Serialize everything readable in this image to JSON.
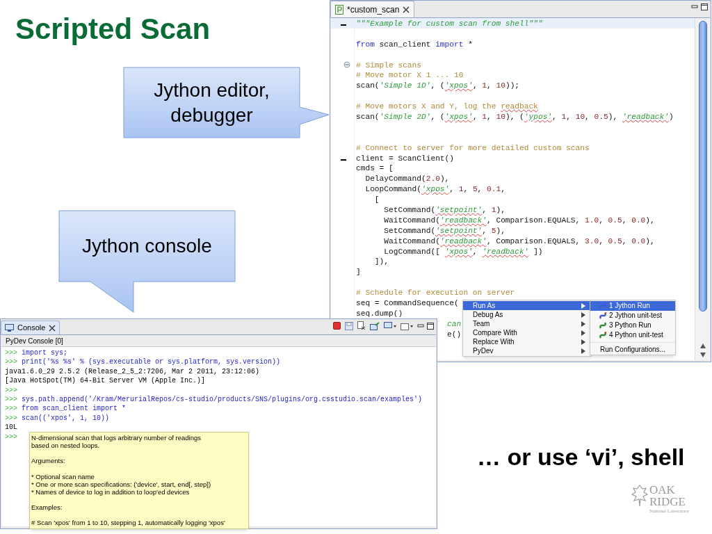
{
  "slide": {
    "title": "Scripted Scan",
    "callouts": [
      {
        "text": "Jython editor, debugger"
      },
      {
        "text": "Jython console"
      }
    ],
    "footer_text": "… or use ‘vi’, shell",
    "logo": {
      "line_1": "OAK",
      "line_2": "RIDGE",
      "line_3": "National Laboratory"
    }
  },
  "editor": {
    "tab": {
      "title": "*custom_scan"
    },
    "lines": [
      {
        "current": true,
        "marked": true,
        "foldable": false,
        "tokens": [
          {
            "kind": "docstring",
            "text": "\"\"\"Example for custom scan from shell\"\"\""
          }
        ]
      },
      {
        "current": false,
        "marked": false,
        "foldable": false
      },
      {
        "current": false,
        "marked": false,
        "foldable": false,
        "tokens": [
          {
            "kind": "keyword",
            "text": "from"
          },
          {
            "kind": "plain",
            "text": " scan_client "
          },
          {
            "kind": "keyword",
            "text": "import"
          },
          {
            "kind": "plain",
            "text": " *"
          }
        ]
      },
      {
        "current": false,
        "marked": false,
        "foldable": false
      },
      {
        "current": false,
        "marked": false,
        "foldable": true,
        "tokens": [
          {
            "kind": "comment",
            "text": "# Simple scans"
          }
        ]
      },
      {
        "current": false,
        "marked": false,
        "foldable": false,
        "tokens": [
          {
            "kind": "comment",
            "text": "# Move motor X 1 ... 10"
          }
        ]
      },
      {
        "current": false,
        "marked": false,
        "foldable": false,
        "tokens": [
          {
            "kind": "plain",
            "text": "scan("
          },
          {
            "kind": "string",
            "text": "'Simple 1D'"
          },
          {
            "kind": "plain",
            "text": ", ("
          },
          {
            "kind": "string",
            "text": "'xpos'",
            "squiggle": true
          },
          {
            "kind": "plain",
            "text": ", "
          },
          {
            "kind": "number",
            "text": "1"
          },
          {
            "kind": "plain",
            "text": ", "
          },
          {
            "kind": "number",
            "text": "10"
          },
          {
            "kind": "plain",
            "text": "));"
          }
        ]
      },
      {
        "current": false,
        "marked": false,
        "foldable": false
      },
      {
        "current": false,
        "marked": false,
        "foldable": false,
        "tokens": [
          {
            "kind": "comment",
            "text": "# Move motors X and Y, log the "
          },
          {
            "kind": "comment",
            "text": "readback",
            "squiggle": true
          }
        ]
      },
      {
        "current": false,
        "marked": false,
        "foldable": false,
        "tokens": [
          {
            "kind": "plain",
            "text": "scan("
          },
          {
            "kind": "string",
            "text": "'Simple 2D'"
          },
          {
            "kind": "plain",
            "text": ", ("
          },
          {
            "kind": "string",
            "text": "'xpos'",
            "squiggle": true
          },
          {
            "kind": "plain",
            "text": ", "
          },
          {
            "kind": "number",
            "text": "1"
          },
          {
            "kind": "plain",
            "text": ", "
          },
          {
            "kind": "number",
            "text": "10"
          },
          {
            "kind": "plain",
            "text": "), ("
          },
          {
            "kind": "string",
            "text": "'ypos'",
            "squiggle": true
          },
          {
            "kind": "plain",
            "text": ", "
          },
          {
            "kind": "number",
            "text": "1"
          },
          {
            "kind": "plain",
            "text": ", "
          },
          {
            "kind": "number",
            "text": "10"
          },
          {
            "kind": "plain",
            "text": ", "
          },
          {
            "kind": "number",
            "text": "0.5"
          },
          {
            "kind": "plain",
            "text": "), "
          },
          {
            "kind": "string",
            "text": "'readback'",
            "squiggle": true
          },
          {
            "kind": "plain",
            "text": ")"
          }
        ]
      },
      {
        "current": false,
        "marked": false,
        "foldable": false
      },
      {
        "current": false,
        "marked": false,
        "foldable": false
      },
      {
        "current": false,
        "marked": false,
        "foldable": false,
        "tokens": [
          {
            "kind": "comment",
            "text": "# Connect to server for more detailed custom scans"
          }
        ]
      },
      {
        "current": false,
        "marked": true,
        "foldable": false,
        "tokens": [
          {
            "kind": "plain",
            "text": "client = ScanClient()"
          }
        ]
      },
      {
        "current": false,
        "marked": false,
        "foldable": false,
        "tokens": [
          {
            "kind": "plain",
            "text": "cmds = ["
          }
        ]
      },
      {
        "current": false,
        "marked": false,
        "foldable": false,
        "tokens": [
          {
            "kind": "plain",
            "text": "  DelayCommand("
          },
          {
            "kind": "number",
            "text": "2.0"
          },
          {
            "kind": "plain",
            "text": "),"
          }
        ]
      },
      {
        "current": false,
        "marked": false,
        "foldable": false,
        "tokens": [
          {
            "kind": "plain",
            "text": "  LoopCommand("
          },
          {
            "kind": "string",
            "text": "'xpos'",
            "squiggle": true
          },
          {
            "kind": "plain",
            "text": ", "
          },
          {
            "kind": "number",
            "text": "1"
          },
          {
            "kind": "plain",
            "text": ", "
          },
          {
            "kind": "number",
            "text": "5"
          },
          {
            "kind": "plain",
            "text": ", "
          },
          {
            "kind": "number",
            "text": "0.1"
          },
          {
            "kind": "plain",
            "text": ","
          }
        ]
      },
      {
        "current": false,
        "marked": false,
        "foldable": false,
        "tokens": [
          {
            "kind": "plain",
            "text": "    ["
          }
        ]
      },
      {
        "current": false,
        "marked": false,
        "foldable": false,
        "tokens": [
          {
            "kind": "plain",
            "text": "      SetCommand("
          },
          {
            "kind": "string",
            "text": "'setpoint'",
            "squiggle": true
          },
          {
            "kind": "plain",
            "text": ", "
          },
          {
            "kind": "number",
            "text": "1"
          },
          {
            "kind": "plain",
            "text": "),"
          }
        ]
      },
      {
        "current": false,
        "marked": false,
        "foldable": false,
        "tokens": [
          {
            "kind": "plain",
            "text": "      WaitCommand("
          },
          {
            "kind": "string",
            "text": "'readback'",
            "squiggle": true
          },
          {
            "kind": "plain",
            "text": ", Comparison.EQUALS, "
          },
          {
            "kind": "number",
            "text": "1.0"
          },
          {
            "kind": "plain",
            "text": ", "
          },
          {
            "kind": "number",
            "text": "0.5"
          },
          {
            "kind": "plain",
            "text": ", "
          },
          {
            "kind": "number",
            "text": "0.0"
          },
          {
            "kind": "plain",
            "text": "),"
          }
        ]
      },
      {
        "current": false,
        "marked": false,
        "foldable": false,
        "tokens": [
          {
            "kind": "plain",
            "text": "      SetCommand("
          },
          {
            "kind": "string",
            "text": "'setpoint'",
            "squiggle": true
          },
          {
            "kind": "plain",
            "text": ", "
          },
          {
            "kind": "number",
            "text": "5"
          },
          {
            "kind": "plain",
            "text": "),"
          }
        ]
      },
      {
        "current": false,
        "marked": false,
        "foldable": false,
        "tokens": [
          {
            "kind": "plain",
            "text": "      WaitCommand("
          },
          {
            "kind": "string",
            "text": "'readback'",
            "squiggle": true
          },
          {
            "kind": "plain",
            "text": ", Comparison.EQUALS, "
          },
          {
            "kind": "number",
            "text": "3.0"
          },
          {
            "kind": "plain",
            "text": ", "
          },
          {
            "kind": "number",
            "text": "0.5"
          },
          {
            "kind": "plain",
            "text": ", "
          },
          {
            "kind": "number",
            "text": "0.0"
          },
          {
            "kind": "plain",
            "text": "),"
          }
        ]
      },
      {
        "current": false,
        "marked": false,
        "foldable": false,
        "tokens": [
          {
            "kind": "plain",
            "text": "      LogCommand([ "
          },
          {
            "kind": "string",
            "text": "'xpos'",
            "squiggle": true
          },
          {
            "kind": "plain",
            "text": ", "
          },
          {
            "kind": "string",
            "text": "'readback'",
            "squiggle": true
          },
          {
            "kind": "plain",
            "text": " ])"
          }
        ]
      },
      {
        "current": false,
        "marked": false,
        "foldable": false,
        "tokens": [
          {
            "kind": "plain",
            "text": "    ]),"
          }
        ]
      },
      {
        "current": false,
        "marked": false,
        "foldable": false,
        "tokens": [
          {
            "kind": "plain",
            "text": "]"
          }
        ]
      },
      {
        "current": false,
        "marked": false,
        "foldable": false
      },
      {
        "current": false,
        "marked": false,
        "foldable": false,
        "tokens": [
          {
            "kind": "comment",
            "text": "# Schedule for execution on server"
          }
        ]
      },
      {
        "current": false,
        "marked": false,
        "foldable": false,
        "tokens": [
          {
            "kind": "plain",
            "text": "seq = CommandSequence("
          }
        ]
      },
      {
        "current": false,
        "marked": false,
        "foldable": false,
        "tokens": [
          {
            "kind": "plain",
            "text": "seq.dump()"
          }
        ]
      }
    ],
    "lines_beside_console": [
      {
        "tokens": [
          {
            "kind": "docstring",
            "text": "can"
          }
        ]
      },
      {
        "tokens": [
          {
            "kind": "plain",
            "text": "e()"
          }
        ]
      }
    ]
  },
  "context_menu": {
    "items": [
      {
        "label": "Run As",
        "selected": true
      },
      {
        "label": "Debug As",
        "selected": false
      },
      {
        "label": "Team",
        "selected": false
      },
      {
        "label": "Compare With",
        "selected": false
      },
      {
        "label": "Replace With",
        "selected": false
      },
      {
        "label": "PyDev",
        "selected": false
      }
    ]
  },
  "submenu": {
    "items": [
      {
        "label": "1 Jython Run",
        "selected": true,
        "kind": "jython"
      },
      {
        "label": "2 Jython unit-test",
        "selected": false,
        "kind": "jython_test"
      },
      {
        "label": "3 Python Run",
        "selected": false,
        "kind": "python"
      },
      {
        "label": "4 Python unit-test",
        "selected": false,
        "kind": "python_test"
      }
    ],
    "footer_item": "Run Configurations..."
  },
  "console": {
    "tab": {
      "title": "Console"
    },
    "header": "PyDev Console [0]",
    "lines": [
      {
        "kind": "input",
        "prompt": ">>>",
        "text": "import sys;"
      },
      {
        "kind": "input",
        "prompt": ">>>",
        "text": "print('%s %s' % (sys.executable or sys.platform, sys.version))"
      },
      {
        "kind": "output",
        "text": "java1.6.0_29 2.5.2 (Release_2_5_2:7206, Mar 2 2011, 23:12:06)"
      },
      {
        "kind": "output",
        "text": "[Java HotSpot(TM) 64-Bit Server VM (Apple Inc.)]"
      },
      {
        "kind": "input",
        "prompt": ">>>"
      },
      {
        "kind": "input",
        "prompt": ">>>",
        "text": "sys.path.append('/Kram/MerurialRepos/cs-studio/products/SNS/plugins/org.csstudio.scan/examples')"
      },
      {
        "kind": "input",
        "prompt": ">>>",
        "text": "from scan_client import *"
      },
      {
        "kind": "input",
        "prompt": ">>>",
        "text": "scan(('xpos', 1, 10))"
      },
      {
        "kind": "output",
        "text": "10L"
      },
      {
        "kind": "input",
        "prompt": ">>>"
      }
    ],
    "tooltip": {
      "paragraphs": [
        "N-dimensional scan that logs arbitrary number of readings\nbased on nested loops.",
        "Arguments:",
        "* Optional scan name\n* One or more scan specifications: ('device', start, end[, step])\n* Names of device to log in addition to loop'ed devices",
        "Examples:",
        "# Scan 'xpos' from 1 to 10, stepping 1, automatically logging 'xpos'"
      ]
    }
  }
}
